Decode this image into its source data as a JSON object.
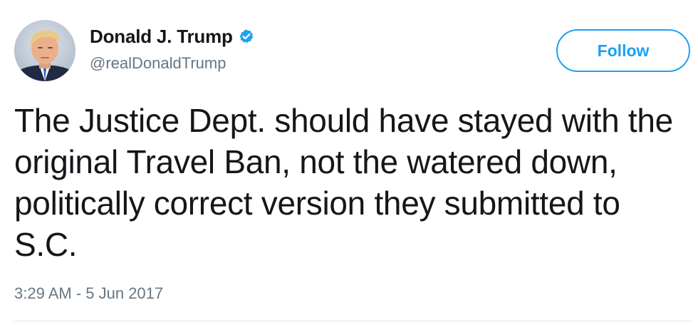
{
  "user": {
    "display_name": "Donald J. Trump",
    "handle": "@realDonaldTrump",
    "verified": true,
    "avatar_icon": "profile-photo"
  },
  "actions": {
    "follow_label": "Follow"
  },
  "tweet": {
    "text": "The Justice Dept. should have stayed with the original Travel Ban, not the watered down, politically correct version they submitted to S.C.",
    "timestamp": "3:29 AM - 5 Jun 2017"
  },
  "colors": {
    "accent": "#1da1f2",
    "text": "#14171a",
    "muted": "#657786",
    "divider": "#e1e8ed"
  },
  "icons": {
    "verified": "verified-badge-icon"
  }
}
